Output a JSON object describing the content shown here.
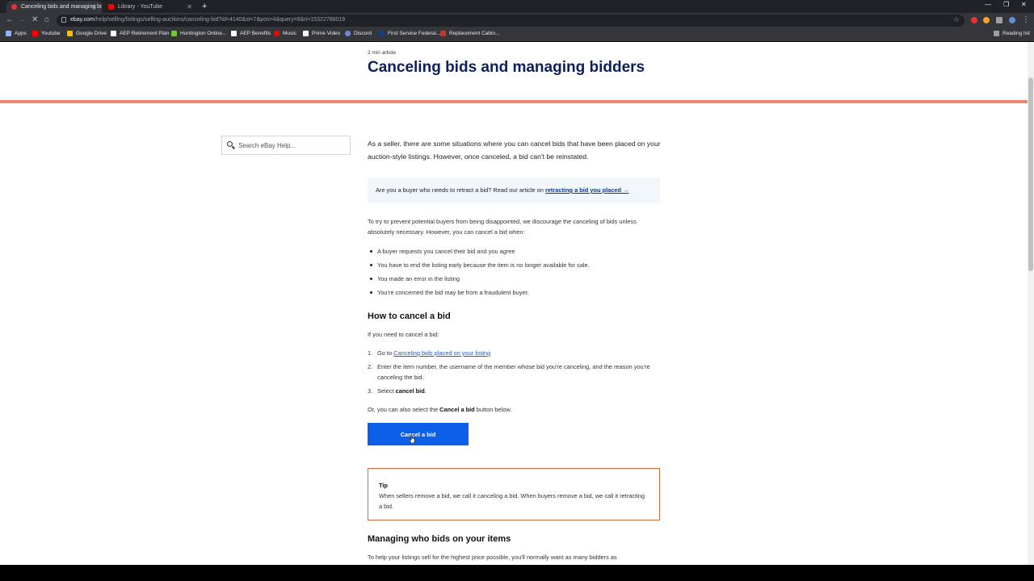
{
  "browser": {
    "tabs": [
      {
        "title": "Canceling bids and managing bi"
      },
      {
        "title": "Library - YouTube"
      }
    ],
    "url_host": "ebay.com",
    "url_path": "/help/selling/listings/selling-auctions/canceling-bid?id=4140&st=7&pos=4&query=8&ri=15322788019",
    "bookmarks": [
      "Apps",
      "Youtube",
      "Google Drive",
      "AEP Retirement Plan",
      "Huntington Online...",
      "AEP Benefits",
      "Music",
      "Prime Video",
      "Discord",
      "First Service Federal...",
      "Replacement Cabin..."
    ],
    "reading_list": "Reading list"
  },
  "article": {
    "meta": "2 min article",
    "title": "Canceling bids and managing bidders",
    "intro": "As a seller, there are some situations where you can cancel bids that have been placed on your auction-style listings. However, once canceled, a bid can't be reinstated.",
    "callout_text": "Are you a buyer who needs to retract a bid? Read our article on ",
    "callout_link": "retracting a bid you placed →",
    "para2": "To try to prevent potential buyers from being disappointed, we discourage the canceling of bids unless absolutely necessary. However, you can cancel a bid when:",
    "bullets": [
      "A buyer requests you cancel their bid and you agree",
      "You have to end the listing early because the item is no longer available for sale.",
      "You made an error in the listing",
      "You're concerned the bid may be from a fraudulent buyer."
    ],
    "h_cancel": "How to cancel a bid",
    "cancel_intro": "If you need to cancel a bid:",
    "step1_prefix": "Go to ",
    "step1_link": "Canceling bids placed on your listing",
    "step2": "Enter the item number, the username of the member whose bid you're canceling, and the reason you're canceling the bid.",
    "step3_prefix": "Select ",
    "step3_bold": "cancel bid",
    "step3_suffix": ".",
    "or_prefix": "Or, you can also select the ",
    "or_bold": "Cancel a bid",
    "or_suffix": " button below.",
    "button_label": "Cancel a bid",
    "tip_title": "Tip",
    "tip_body": "When sellers remove a bid, we call it canceling a bid. When buyers remove a bid, we call it retracting a bid.",
    "h_managing": "Managing who bids on your items",
    "managing_intro": "To help your listings sell for the highest price possible, you'll normally want as many bidders as"
  },
  "search": {
    "placeholder": "Search eBay Help..."
  }
}
